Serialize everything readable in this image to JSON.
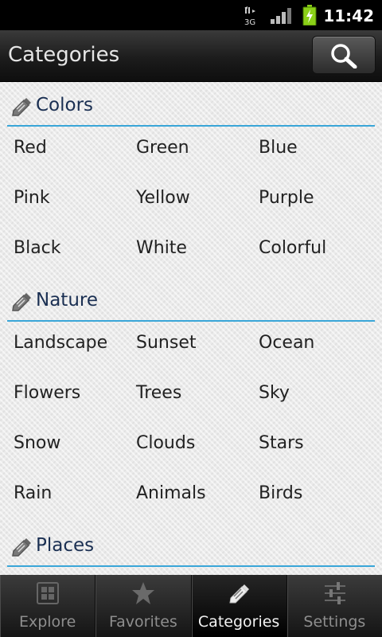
{
  "status": {
    "network": "3G",
    "time": "11:42"
  },
  "header": {
    "title": "Categories"
  },
  "sections": [
    {
      "title": "Colors",
      "items": [
        "Red",
        "Green",
        "Blue",
        "Pink",
        "Yellow",
        "Purple",
        "Black",
        "White",
        "Colorful"
      ]
    },
    {
      "title": "Nature",
      "items": [
        "Landscape",
        "Sunset",
        "Ocean",
        "Flowers",
        "Trees",
        "Sky",
        "Snow",
        "Clouds",
        "Stars",
        "Rain",
        "Animals",
        "Birds"
      ]
    },
    {
      "title": "Places",
      "items": []
    }
  ],
  "tabs": [
    {
      "label": "Explore",
      "icon": "grid-icon"
    },
    {
      "label": "Favorites",
      "icon": "star-icon"
    },
    {
      "label": "Categories",
      "icon": "tag-icon"
    },
    {
      "label": "Settings",
      "icon": "sliders-icon"
    }
  ],
  "colors": {
    "accent": "#3aa6d8",
    "section_title": "#1a2f52"
  }
}
